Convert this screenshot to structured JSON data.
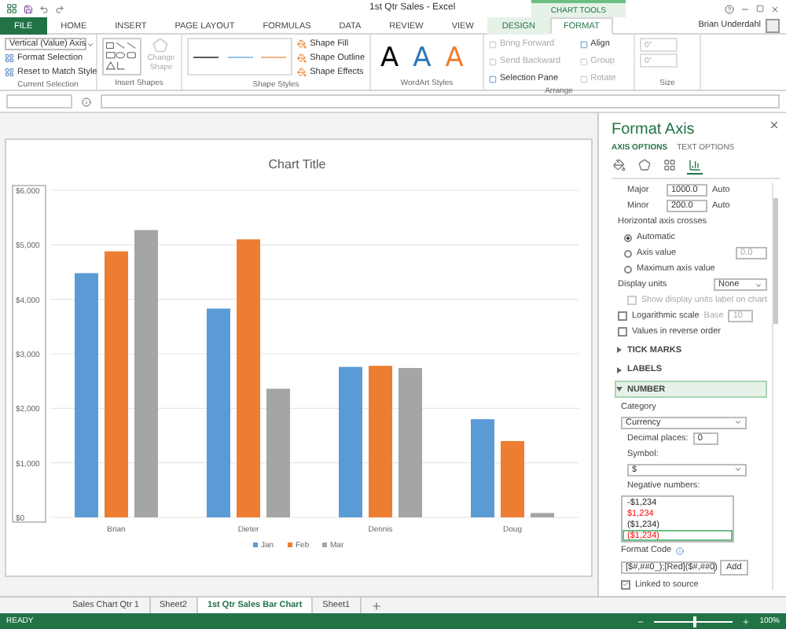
{
  "title_bar": {
    "title": "1st Qtr Sales - Excel",
    "context_label": "CHART TOOLS",
    "user": "Brian Underdahl"
  },
  "ribbon_tabs": [
    {
      "label": "FILE",
      "kind": "file",
      "selected": false
    },
    {
      "label": "HOME",
      "kind": "normal",
      "selected": false
    },
    {
      "label": "INSERT",
      "kind": "normal",
      "selected": false
    },
    {
      "label": "PAGE LAYOUT",
      "kind": "normal",
      "selected": false
    },
    {
      "label": "FORMULAS",
      "kind": "normal",
      "selected": false
    },
    {
      "label": "DATA",
      "kind": "normal",
      "selected": false
    },
    {
      "label": "REVIEW",
      "kind": "normal",
      "selected": false
    },
    {
      "label": "VIEW",
      "kind": "normal",
      "selected": false
    },
    {
      "label": "DESIGN",
      "kind": "contextual",
      "selected": false
    },
    {
      "label": "FORMAT",
      "kind": "contextual",
      "selected": true
    }
  ],
  "ribbon_groups": [
    {
      "kind": "selection",
      "label": "Current Selection",
      "selector": "Vertical (Value) Axis",
      "commands": [
        {
          "label": "Format Selection",
          "disabled": false
        },
        {
          "label": "Reset to Match Style",
          "disabled": false
        }
      ]
    },
    {
      "kind": "shapes",
      "label": "Insert Shapes",
      "change_shape": {
        "label": "Change Shape",
        "disabled": true
      }
    },
    {
      "kind": "styles",
      "label": "Shape Styles",
      "samples": [
        {
          "color": "#595959"
        },
        {
          "color": "#9dc3e6"
        },
        {
          "color": "#f4b183"
        }
      ],
      "commands": [
        {
          "label": "Shape Fill",
          "disabled": false
        },
        {
          "label": "Shape Outline",
          "disabled": false
        },
        {
          "label": "Shape Effects",
          "disabled": false
        }
      ]
    },
    {
      "kind": "wordart",
      "label": "WordArt Styles",
      "samples": [
        {
          "text": "A",
          "color": "#000000"
        },
        {
          "text": "A",
          "color": "#2e75b6"
        },
        {
          "text": "A",
          "color": "#ed7d31"
        }
      ]
    },
    {
      "kind": "arrange",
      "label": "Arrange",
      "commands": [
        {
          "label": "Bring Forward",
          "disabled": true
        },
        {
          "label": "Align",
          "disabled": false
        },
        {
          "label": "Send Backward",
          "disabled": true
        },
        {
          "label": "Group",
          "disabled": true
        },
        {
          "label": "Selection Pane",
          "disabled": false
        },
        {
          "label": "Rotate",
          "disabled": true
        }
      ]
    },
    {
      "kind": "size",
      "label": "Size",
      "fields": [
        {
          "value": "0\"",
          "disabled": true
        },
        {
          "value": "0\"",
          "disabled": true
        }
      ]
    }
  ],
  "chart": {
    "chart_data": {
      "type": "bar",
      "title": "Chart Title",
      "categories": [
        "Brian",
        "Dieter",
        "Dennis",
        "Doug"
      ],
      "series": [
        {
          "name": "Jan",
          "color": "#5b9bd5",
          "values": [
            4480,
            3830,
            2760,
            1800
          ]
        },
        {
          "name": "Feb",
          "color": "#ed7d31",
          "values": [
            4880,
            5100,
            2780,
            1400
          ]
        },
        {
          "name": "Mar",
          "color": "#a5a5a5",
          "values": [
            5270,
            2360,
            2740,
            80
          ]
        }
      ],
      "ylim": [
        0,
        6000
      ],
      "grid": true,
      "legend": true,
      "yticks": [
        {
          "value": 0,
          "label": "$0"
        },
        {
          "value": 1000,
          "label": "$1,000"
        },
        {
          "value": 2000,
          "label": "$2,000"
        },
        {
          "value": 3000,
          "label": "$3,000"
        },
        {
          "value": 4000,
          "label": "$4,000"
        },
        {
          "value": 5000,
          "label": "$5,000"
        },
        {
          "value": 6000,
          "label": "$6,000"
        }
      ]
    }
  },
  "format_pane": {
    "title": "Format Axis",
    "tabs": [
      {
        "label": "AXIS OPTIONS",
        "selected": true
      },
      {
        "label": "TEXT OPTIONS",
        "selected": false
      }
    ],
    "category_icons": [
      {
        "kind": "fill",
        "selected": false
      },
      {
        "kind": "effects",
        "selected": false
      },
      {
        "kind": "size",
        "selected": false
      },
      {
        "kind": "options",
        "selected": true
      }
    ],
    "units": [
      {
        "label": "Major",
        "value": "1000.0",
        "mode": "Auto"
      },
      {
        "label": "Minor",
        "value": "200.0",
        "mode": "Auto"
      }
    ],
    "crosses_label": "Horizontal axis crosses",
    "crosses": [
      {
        "label": "Automatic",
        "selected": true
      },
      {
        "label": "Axis value",
        "selected": false,
        "value": "0.0"
      },
      {
        "label": "Maximum axis value",
        "selected": false
      }
    ],
    "display_units": {
      "label": "Display units",
      "value": "None"
    },
    "checks": [
      {
        "label": "Show display units label on chart",
        "checked": false,
        "disabled": true
      },
      {
        "label": "Logarithmic scale",
        "checked": false,
        "disabled": false,
        "base_label": "Base",
        "base_value": "10"
      },
      {
        "label": "Values in reverse order",
        "checked": false,
        "disabled": false
      }
    ],
    "sections": [
      {
        "label": "TICK MARKS",
        "expanded": false
      },
      {
        "label": "LABELS",
        "expanded": false
      },
      {
        "label": "NUMBER",
        "expanded": true
      }
    ],
    "number": {
      "category_label": "Category",
      "category": "Currency",
      "decimal_label": "Decimal places:",
      "decimal_value": "0",
      "symbol_label": "Symbol:",
      "symbol": "$",
      "negative_label": "Negative numbers:",
      "negatives": [
        {
          "text": "-$1,234",
          "red": false,
          "selected": false
        },
        {
          "text": "$1,234",
          "red": true,
          "selected": false
        },
        {
          "text": "($1,234)",
          "red": false,
          "selected": false
        },
        {
          "text": "($1,234)",
          "red": true,
          "selected": true
        }
      ],
      "format_code_label": "Format Code",
      "format_code": "[$#,##0_);[Red]($#,##0)",
      "add_label": "Add",
      "linked_label": "Linked to source",
      "linked": true
    }
  },
  "sheet_tabs": [
    {
      "label": "Sales Chart  Qtr 1",
      "selected": false
    },
    {
      "label": "Sheet2",
      "selected": false
    },
    {
      "label": "1st Qtr Sales Bar Chart",
      "selected": true
    },
    {
      "label": "Sheet1",
      "selected": false
    }
  ],
  "status_bar": {
    "status": "READY",
    "zoom": "100%",
    "zoom_level": {
      "level": 0.5
    }
  }
}
